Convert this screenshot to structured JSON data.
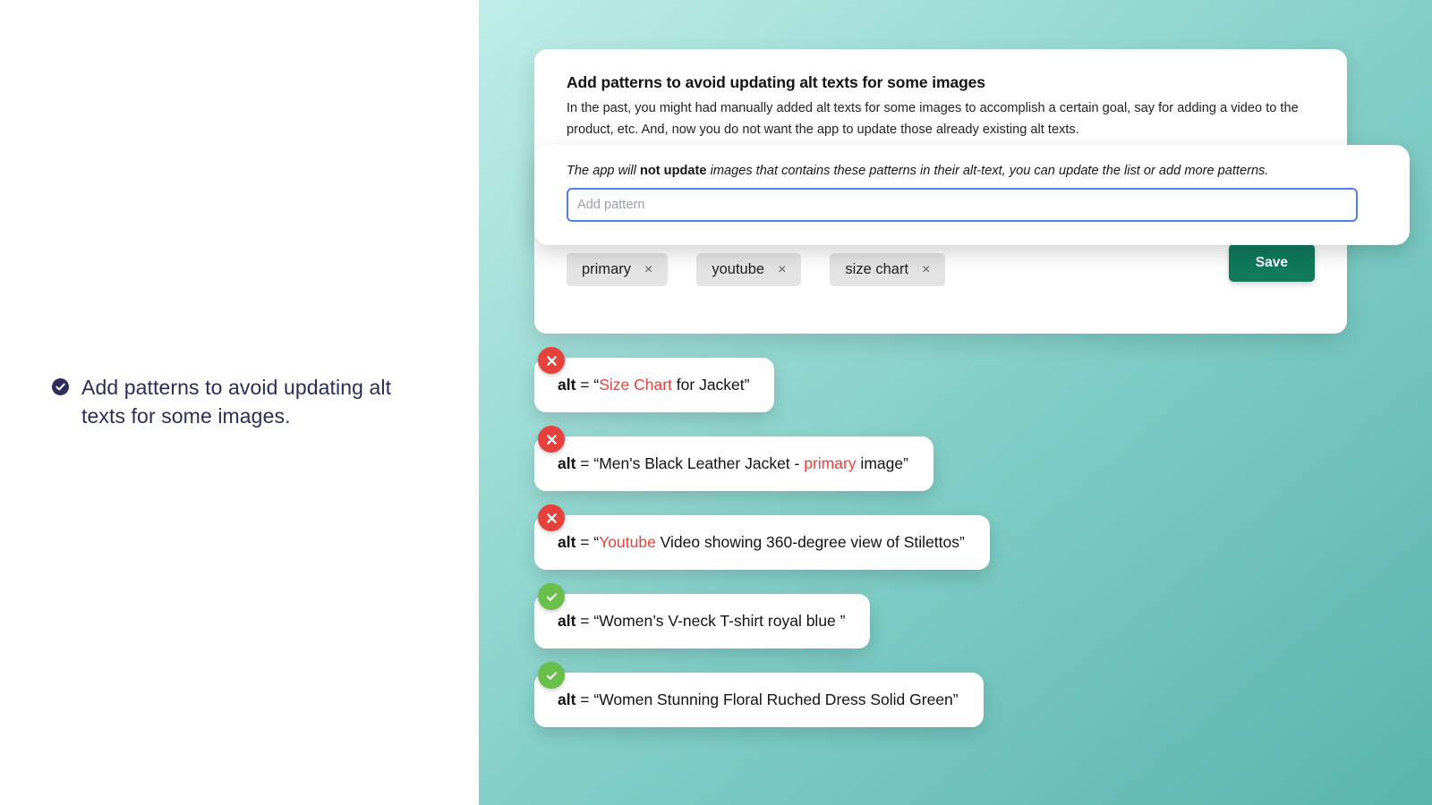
{
  "sidebar": {
    "items": [
      {
        "icon": "check-circle-icon",
        "label": "Add patterns to avoid updating alt texts for some images."
      }
    ]
  },
  "card": {
    "heading": "Add patterns to avoid updating alt texts for some images",
    "description": "In the past, you might had manually added alt texts for some images to accomplish a certain goal, say for adding a video to the product, etc. And, now you do not want the app to update those already existing alt texts.",
    "note_before": "The app will ",
    "note_emphasis": "not update",
    "note_after": " images that contains these patterns in their alt-text, you can update the list or add more patterns.",
    "input": {
      "value": "",
      "placeholder": "Add pattern"
    },
    "tags": [
      {
        "label": "primary",
        "remove": "×"
      },
      {
        "label": "youtube",
        "remove": "×"
      },
      {
        "label": "size chart",
        "remove": "×"
      }
    ],
    "save_label": "Save"
  },
  "results": [
    {
      "status": "error",
      "badge_glyph": "✕",
      "prefix": "alt",
      "equals": " = “",
      "highlight": "Size Chart",
      "rest": " for Jacket”",
      "pre_text": ""
    },
    {
      "status": "error",
      "badge_glyph": "✕",
      "prefix": "alt",
      "equals": " = “",
      "pre_text": "Men's Black Leather Jacket - ",
      "highlight": "primary",
      "rest": " image”"
    },
    {
      "status": "error",
      "badge_glyph": "✕",
      "prefix": "alt",
      "equals": " = “",
      "pre_text": "",
      "highlight": "Youtube",
      "rest": " Video showing 360-degree view of Stilettos”"
    },
    {
      "status": "ok",
      "badge_glyph": "✓",
      "prefix": "alt",
      "equals": " = “",
      "pre_text": "Women’s V-neck T-shirt royal blue ”",
      "highlight": "",
      "rest": ""
    },
    {
      "status": "ok",
      "badge_glyph": "✓",
      "prefix": "alt",
      "equals": " = “",
      "pre_text": "Women Stunning Floral Ruched Dress Solid Green”",
      "highlight": "",
      "rest": ""
    }
  ],
  "colors": {
    "accent_green": "#107A5A",
    "error_red": "#E8413C",
    "success_green": "#6ABF4B",
    "sidebar_navy": "#2B2D5B",
    "focus_blue": "#4F7DF3",
    "teal_light": "#BFEDE8",
    "teal_dark": "#59B5AE"
  }
}
